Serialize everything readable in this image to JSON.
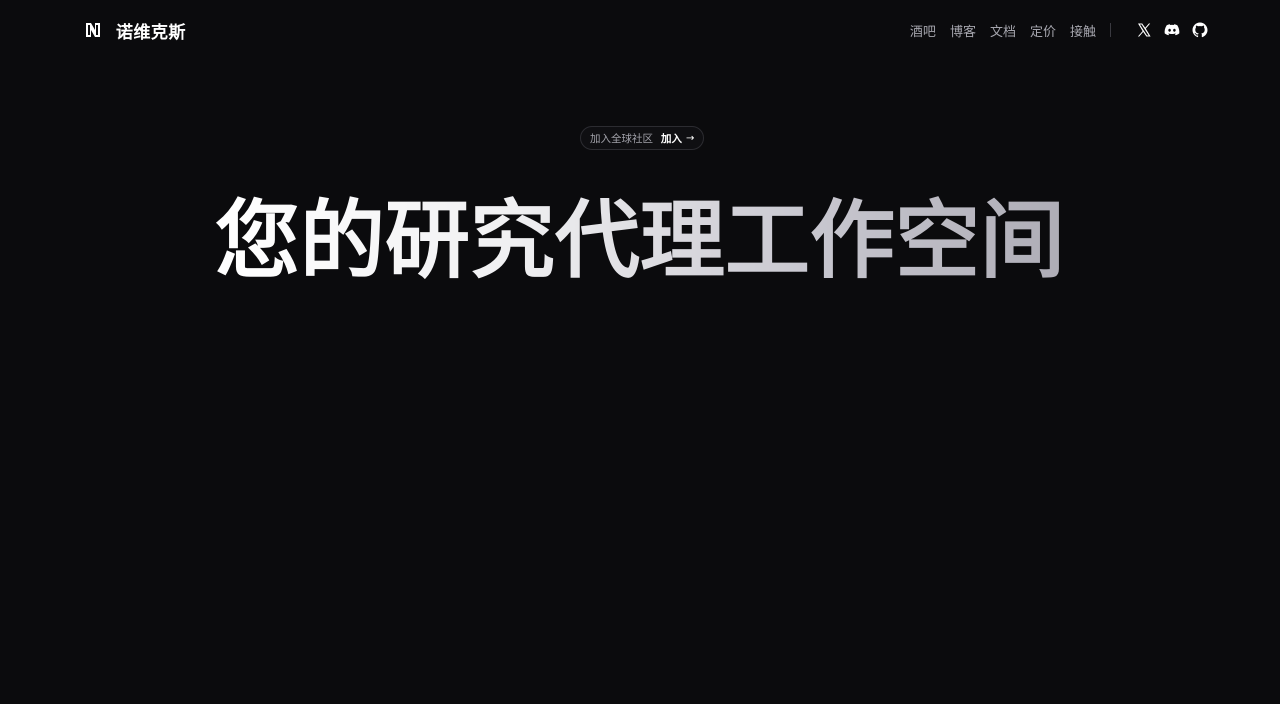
{
  "brand": {
    "name": "诺维克斯",
    "logo_icon": "n-logo-icon"
  },
  "nav": {
    "links": [
      "酒吧",
      "博客",
      "文档",
      "定价",
      "接触"
    ],
    "social": [
      {
        "icon": "x-icon"
      },
      {
        "icon": "discord-icon"
      },
      {
        "icon": "github-icon"
      }
    ]
  },
  "community": {
    "text": "加入全球社区",
    "action": "加入",
    "arrow_icon": "arrow-right-icon"
  },
  "hero": {
    "title": "您的研究代理工作空间"
  },
  "colors": {
    "background": "#0b0b0d",
    "nav_text": "#a5a5ad",
    "title_gradient_start": "#ffffff",
    "title_gradient_end": "#aeadb6"
  }
}
